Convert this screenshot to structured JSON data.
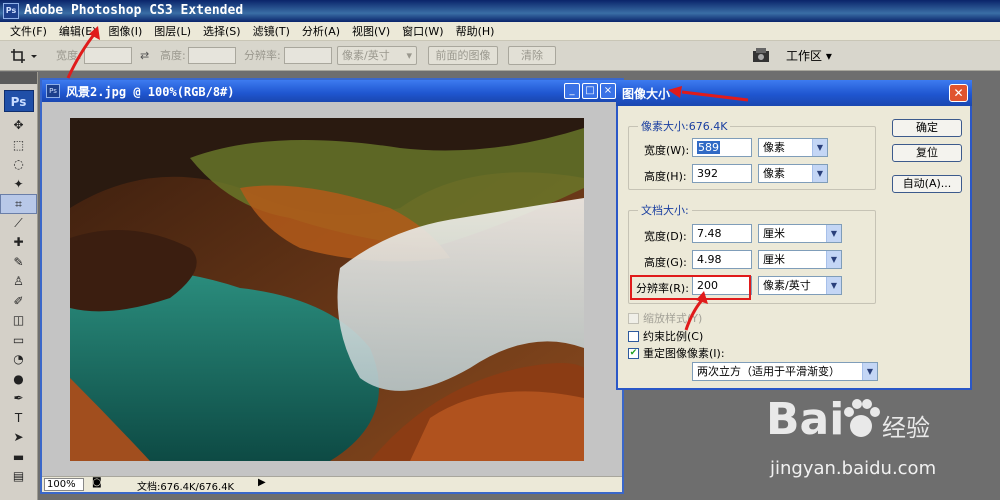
{
  "app": {
    "title": "Adobe Photoshop CS3 Extended",
    "logo": "Ps"
  },
  "menu": [
    "文件(F)",
    "编辑(E)",
    "图像(I)",
    "图层(L)",
    "选择(S)",
    "滤镜(T)",
    "分析(A)",
    "视图(V)",
    "窗口(W)",
    "帮助(H)"
  ],
  "options": {
    "width_label": "宽度:",
    "height_label": "高度:",
    "resolution_label": "分辨率:",
    "unit_select": "像素/英寸",
    "front_image_button": "前面的图像",
    "clear_button": "清除",
    "workspace_button": "工作区 ▾"
  },
  "toolbox": {
    "badge": "Ps"
  },
  "document": {
    "title": "风景2.jpg @ 100%(RGB/8#)",
    "zoom": "100%",
    "doc_size": "文档:676.4K/676.4K"
  },
  "dialog": {
    "title": "图像大小",
    "pixel_group_label": "像素大小:676.4K",
    "pixel_width_label": "宽度(W):",
    "pixel_width_value": "589",
    "pixel_width_unit": "像素",
    "pixel_height_label": "高度(H):",
    "pixel_height_value": "392",
    "pixel_height_unit": "像素",
    "doc_group_label": "文档大小:",
    "doc_width_label": "宽度(D):",
    "doc_width_value": "7.48",
    "doc_width_unit": "厘米",
    "doc_height_label": "高度(G):",
    "doc_height_value": "4.98",
    "doc_height_unit": "厘米",
    "resolution_label": "分辨率(R):",
    "resolution_value": "200",
    "resolution_unit": "像素/英寸",
    "scale_styles": "缩放样式(Y)",
    "constrain": "约束比例(C)",
    "resample": "重定图像像素(I):",
    "resample_method": "两次立方（适用于平滑渐变）",
    "ok_button": "确定",
    "reset_button": "复位",
    "auto_button": "自动(A)..."
  },
  "watermark": {
    "brand": "Bai",
    "suffix": "经验",
    "url": "jingyan.baidu.com"
  },
  "colors": {
    "accent": "#e01b1b",
    "titlebar": "#0a246a",
    "xp_blue": "#1f56d0"
  }
}
